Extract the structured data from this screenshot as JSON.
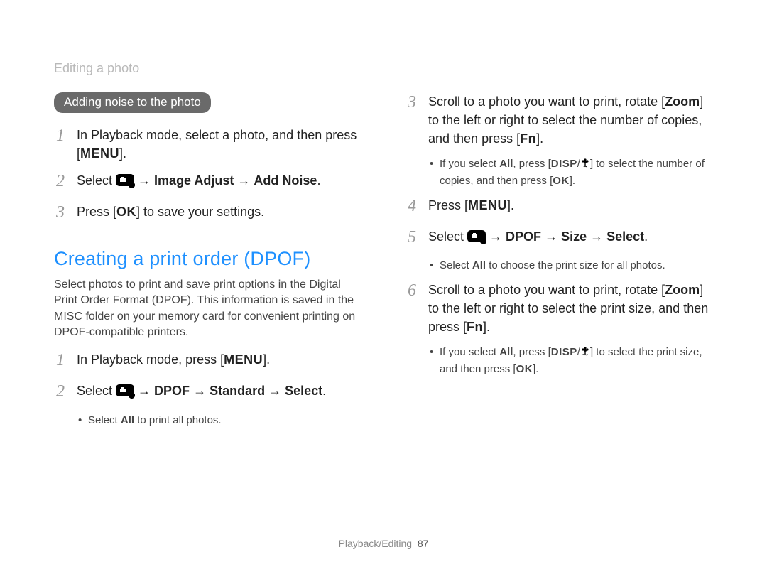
{
  "breadcrumb": "Editing a photo",
  "left": {
    "pill": "Adding noise to the photo",
    "steps": [
      {
        "num": "1",
        "pre": "In Playback mode, select a photo, and then press [",
        "btn": "MENU",
        "post": "]."
      },
      {
        "num": "2",
        "pre": "Select ",
        "icon": "toolbox",
        "arrow1": " → ",
        "bold1": "Image Adjust",
        "arrow2": " → ",
        "bold2": "Add Noise",
        "post": "."
      },
      {
        "num": "3",
        "pre": "Press [",
        "btn": "OK",
        "post": "] to save your settings."
      }
    ],
    "heading": "Creating a print order (DPOF)",
    "para": "Select photos to print and save print options in the Digital Print Order Format (DPOF). This information is saved in the MISC folder on your memory card for convenient printing on DPOF-compatible printers.",
    "steps2": [
      {
        "num": "1",
        "pre": "In Playback mode, press [",
        "btn": "MENU",
        "post": "]."
      },
      {
        "num": "2",
        "pre": "Select ",
        "icon": "toolbox",
        "arrow1": " → ",
        "bold1": "DPOF",
        "arrow2": " → ",
        "bold2": "Standard",
        "arrow3": " → ",
        "bold3": "Select",
        "post": "."
      }
    ],
    "bullets2": [
      {
        "pre": "Select ",
        "bold": "All",
        "post": " to print all photos."
      }
    ]
  },
  "right": {
    "steps": [
      {
        "num": "3",
        "t1": "Scroll to a photo you want to print, rotate [",
        "bold1": "Zoom",
        "t2": "] to the left or right to select the number of copies, and then press [",
        "btn": "Fn",
        "t3": "]."
      }
    ],
    "bullets3": [
      {
        "t1": "If you select ",
        "bold1": "All",
        "t2": ", press [",
        "btn1": "DISP",
        "slash": "/",
        "icon": "flower",
        "t3": "] to select the number of copies, and then press [",
        "btn2": "OK",
        "t4": "]."
      }
    ],
    "steps2": [
      {
        "num": "4",
        "pre": "Press [",
        "btn": "MENU",
        "post": "]."
      },
      {
        "num": "5",
        "pre": "Select ",
        "icon": "toolbox",
        "arrow1": " → ",
        "bold1": "DPOF",
        "arrow2": " → ",
        "bold2": "Size",
        "arrow3": " → ",
        "bold3": "Select",
        "post": "."
      }
    ],
    "bullets5": [
      {
        "pre": "Select ",
        "bold": "All",
        "post": " to choose the print size for all photos."
      }
    ],
    "steps3": [
      {
        "num": "6",
        "t1": "Scroll to a photo you want to print, rotate [",
        "bold1": "Zoom",
        "t2": "] to the left or right to select the print size, and then press [",
        "btn": "Fn",
        "t3": "]."
      }
    ],
    "bullets6": [
      {
        "t1": "If you select ",
        "bold1": "All",
        "t2": ", press [",
        "btn1": "DISP",
        "slash": "/",
        "icon": "flower",
        "t3": "] to select the print size, and then press [",
        "btn2": "OK",
        "t4": "]."
      }
    ]
  },
  "footer": {
    "section": "Playback/Editing",
    "page": "87"
  }
}
